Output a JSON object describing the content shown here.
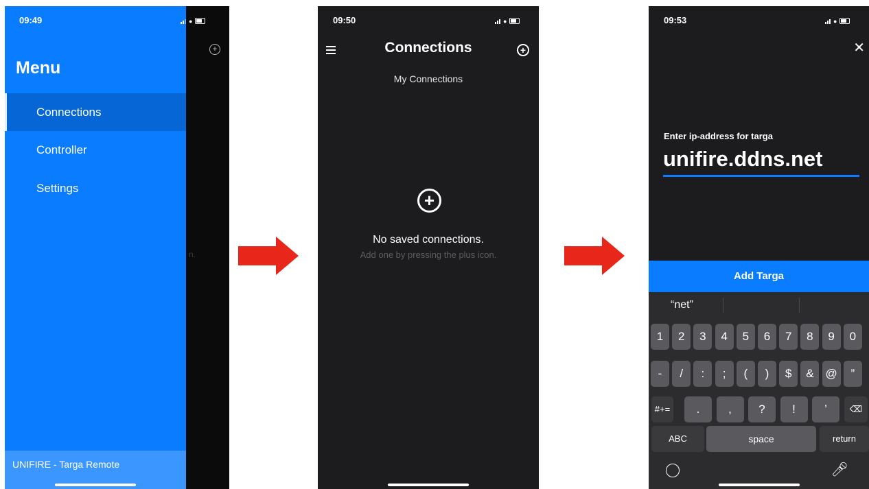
{
  "phone1": {
    "time": "09:49",
    "menu_title": "Menu",
    "menu_items": [
      {
        "label": "Connections",
        "active": true
      },
      {
        "label": "Controller",
        "active": false
      },
      {
        "label": "Settings",
        "active": false
      }
    ],
    "footer": "UNIFIRE - Targa Remote",
    "peek_text": "n.",
    "accent": "#0a7cff"
  },
  "phone2": {
    "time": "09:50",
    "title": "Connections",
    "subtitle": "My Connections",
    "empty_title": "No saved connections.",
    "empty_hint": "Add one by pressing the plus icon."
  },
  "phone3": {
    "time": "09:53",
    "label": "Enter ip-address for targa",
    "ip_value": "unifire.ddns.net",
    "add_button": "Add Targa",
    "suggestion": "“net”",
    "keys_row1": [
      "1",
      "2",
      "3",
      "4",
      "5",
      "6",
      "7",
      "8",
      "9",
      "0"
    ],
    "keys_row2": [
      "-",
      "/",
      ":",
      ";",
      "(",
      ")",
      "$",
      "&",
      "@",
      "”"
    ],
    "keys_row3": [
      ".",
      ",",
      "?",
      "!",
      "’"
    ],
    "key_symbols": "#+=",
    "key_abc": "ABC",
    "key_space": "space",
    "key_return": "return"
  }
}
